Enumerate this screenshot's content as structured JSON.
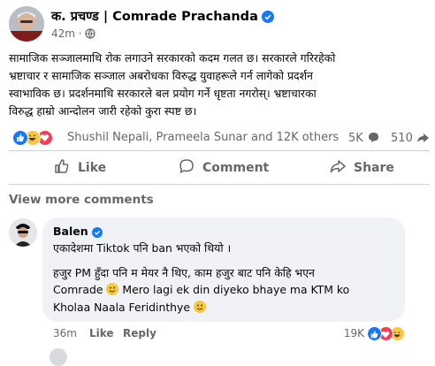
{
  "post": {
    "author": "क. प्रचण्ड | Comrade Prachanda",
    "time": "42m",
    "separator": "·",
    "body_lines": [
      "सामाजिक सञ्जालमाथि रोक लगाउने सरकारको कदम गलत छ। सरकारले गरिरहेको",
      "भ्रष्टाचार र सामाजिक सञ्जाल अबरोधका विरुद्ध युवाहरूले गर्न लागेको प्रदर्शन",
      "स्वाभाविक छ। प्रदर्शनमाथि सरकारले बल प्रयोग गर्ने धृष्टता नगरोस्। भ्रष्टाचारका",
      "विरुद्ध हाम्रो आन्दोलन जारी रहेको कुरा स्पष्ट छ।"
    ],
    "reactions_summary": "Shushil Nepali, Prameela Sunar and 12K others",
    "comment_count": "5K",
    "share_count": "510",
    "actions": {
      "like": "Like",
      "comment": "Comment",
      "share": "Share"
    },
    "view_more_comments": "View more comments"
  },
  "comment": {
    "author": "Balen",
    "lines": [
      "एकादेशमा Tiktok पनि ban भएको थियो ।",
      "हजुर PM हुँदा पनि म मेयर नै थिए, काम हजुर बाट पनि केहि भएन",
      "Comrade",
      "Mero lagi ek din diyeko bhaye ma KTM ko",
      "Kholaa Naala Feridinthye"
    ],
    "time": "36m",
    "like": "Like",
    "reply": "Reply",
    "reaction_count": "19K"
  },
  "colors": {
    "like_blue": "#1877f2",
    "love_red": "#f33e58",
    "haha_yellow": "#f7c740",
    "muted": "#65676b",
    "bubble": "#f0f2f5"
  },
  "icons": [
    "verified-badge-icon",
    "globe-icon",
    "like-icon",
    "love-icon",
    "haha-icon",
    "comment-icon",
    "share-icon",
    "more-icon"
  ]
}
